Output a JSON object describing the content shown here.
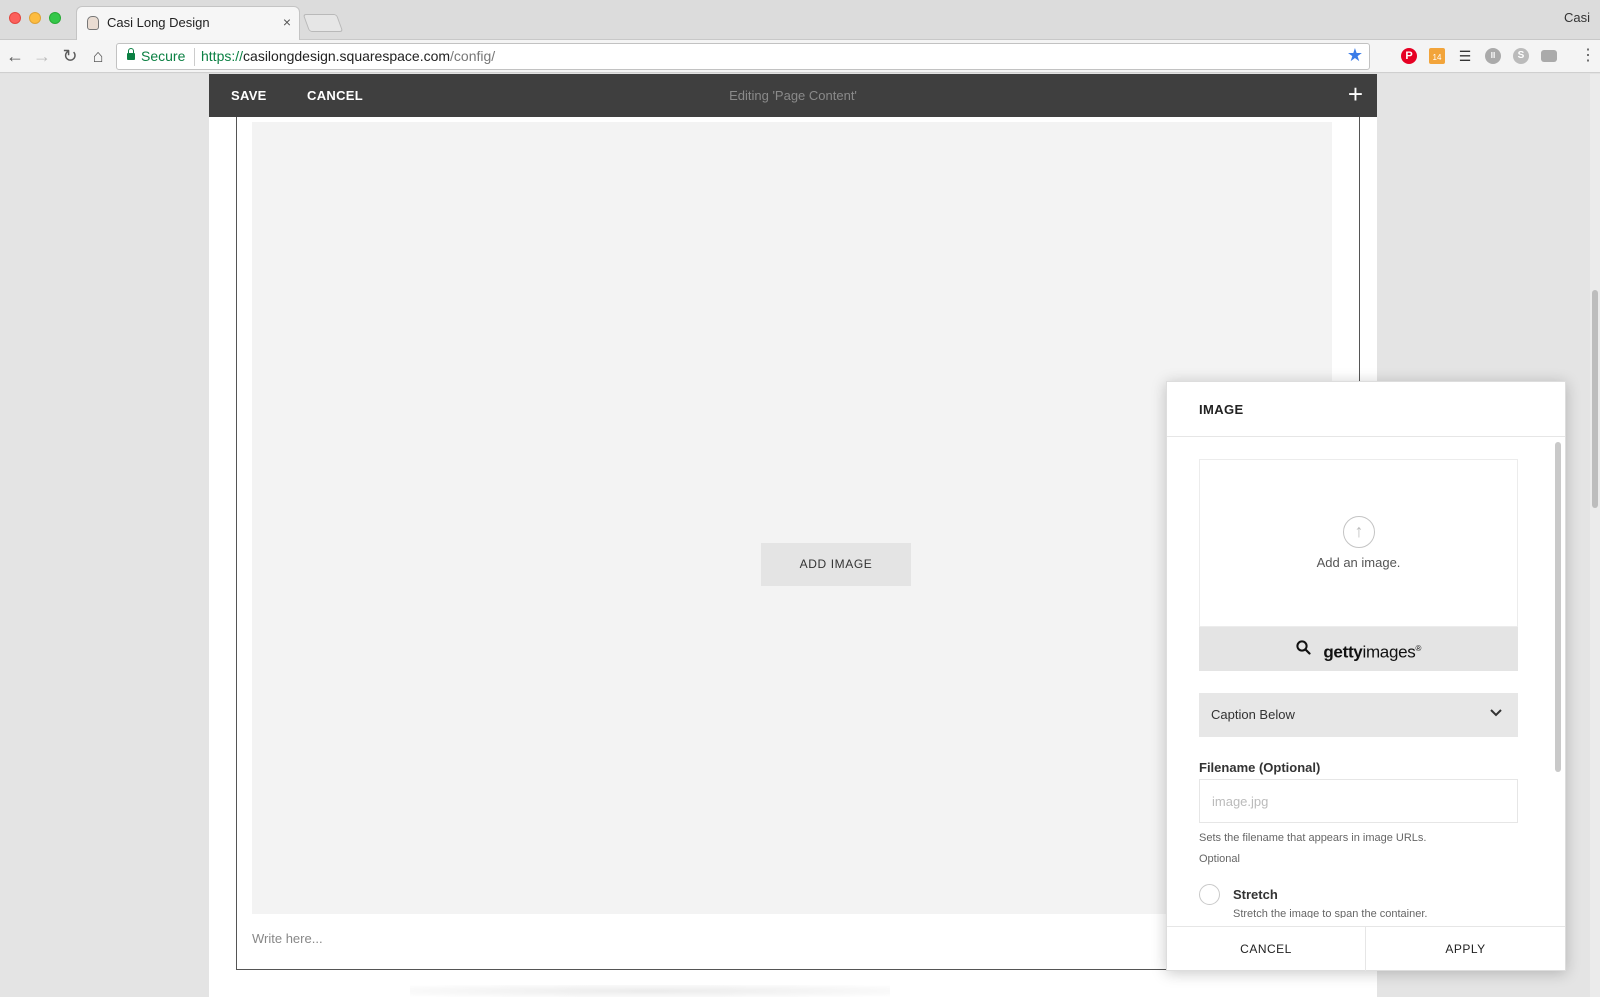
{
  "browser": {
    "tab_title": "Casi Long Design",
    "tab_close": "×",
    "profile_name": "Casi",
    "address": {
      "secure_label": "Secure",
      "protocol": "https://",
      "host": "casilongdesign.squarespace.com",
      "path": "/config/"
    },
    "extensions": {
      "calendar_badge": "14"
    }
  },
  "editor_bar": {
    "save_label": "SAVE",
    "cancel_label": "CANCEL",
    "title": "Editing 'Page Content'",
    "add_icon": "+"
  },
  "content": {
    "add_image_label": "ADD IMAGE",
    "write_placeholder": "Write here..."
  },
  "image_dialog": {
    "title": "IMAGE",
    "dropzone_text": "Add an image.",
    "getty_brand_bold": "getty",
    "getty_brand_rest": "images",
    "getty_mark": "®",
    "caption_value": "Caption Below",
    "filename_label": "Filename (Optional)",
    "filename_placeholder": "image.jpg",
    "filename_help": "Sets the filename that appears in image URLs.",
    "filename_help_optional": "Optional",
    "stretch_label": "Stretch",
    "stretch_desc": "Stretch the image to span the container.",
    "cancel_label": "CANCEL",
    "apply_label": "APPLY"
  },
  "colors": {
    "editor_bar": "#3f3f3f",
    "secure_green": "#0b8043",
    "star_blue": "#3b7ce8"
  },
  "icons": [
    "back-arrow-icon",
    "forward-arrow-icon",
    "reload-icon",
    "home-icon",
    "lock-icon",
    "bookmark-star-icon",
    "pinterest-icon",
    "calendar-icon",
    "layers-icon",
    "pause-icon",
    "skype-icon",
    "camera-icon",
    "menu-dots-icon",
    "plus-icon",
    "upload-arrow-icon",
    "search-icon",
    "chevron-down-icon"
  ]
}
